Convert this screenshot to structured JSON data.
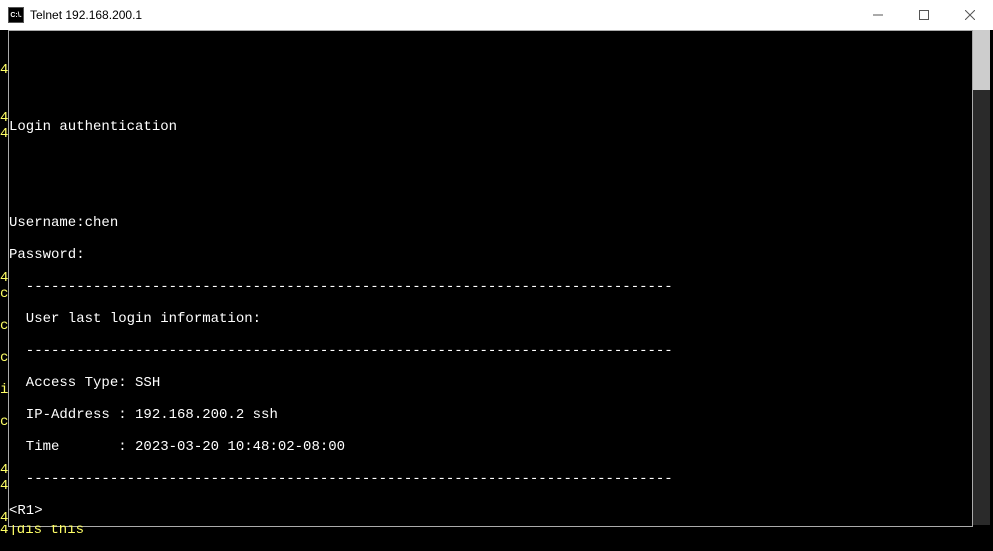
{
  "window": {
    "title": "Telnet 192.168.200.1",
    "icon_text": "C:\\."
  },
  "terminal": {
    "blank1": "",
    "blank2": "",
    "login_header": "Login authentication",
    "blank3": "",
    "blank4": "",
    "username_line": "Username:chen",
    "password_line": "Password:",
    "sep1": "  -----------------------------------------------------------------------------",
    "info_header": "  User last login information:",
    "sep2": "  -----------------------------------------------------------------------------",
    "access_line": "  Access Type: SSH",
    "ip_line": "  IP-Address : 192.168.200.2 ssh",
    "time_line": "  Time       : 2023-03-20 10:48:02-08:00",
    "sep3": "  -----------------------------------------------------------------------------",
    "prompt": "<R1>"
  },
  "gutter": {
    "left": "\n\n4\n\n\n4\n4\n\n\n\n\n\n\n\n\n4\nc\n\nc\n\nc\n\ni\n\nc\n\n\n4\n4\n\n4",
    "bottom": "4]dis this"
  }
}
